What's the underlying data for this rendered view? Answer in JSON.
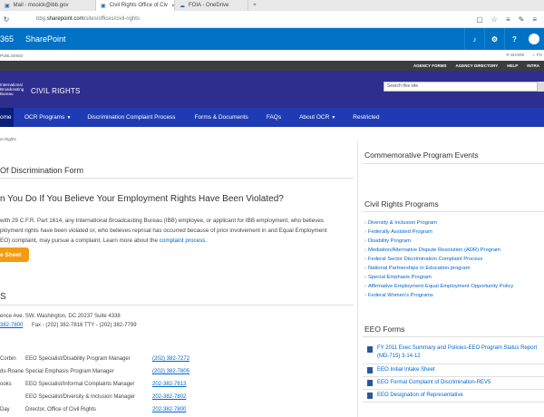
{
  "browser": {
    "tabs": [
      {
        "label": "Mail - mooick@ibb.gov",
        "active": false
      },
      {
        "label": "Civil Rights Office of Civ",
        "active": true
      },
      {
        "label": "FOIA - OneDrive",
        "active": false
      }
    ],
    "new_tab": "+",
    "url_prefix": "bbg.",
    "url_domain": "sharepoint.com",
    "url_path": "/sites/offices/civil-rights"
  },
  "sharepoint": {
    "app_number": "365",
    "app_name": "SharePoint",
    "settings_icon": "⚙",
    "help_icon": "?",
    "bell_icon": "🔔"
  },
  "sharebar": {
    "published": "PUBLISHED",
    "share": "SHARE",
    "follow": "FO"
  },
  "agency": {
    "links": [
      "AGENCY FORMS",
      "AGENCY DIRECTORY",
      "HELP",
      "INTRA"
    ]
  },
  "header": {
    "logo_line1": "International",
    "logo_line2": "Broadcasting",
    "logo_line3": "Bureau",
    "site_name": "CIVIL RIGHTS",
    "search_placeholder": "Search this site"
  },
  "nav": [
    {
      "label": "ome",
      "caret": false
    },
    {
      "label": "OCR Programs",
      "caret": true
    },
    {
      "label": "Discrimination Complaint Process",
      "caret": false
    },
    {
      "label": "Forms & Documents",
      "caret": false
    },
    {
      "label": "FAQs",
      "caret": false
    },
    {
      "label": "About OCR",
      "caret": true
    },
    {
      "label": "Restricted",
      "caret": false
    }
  ],
  "breadcrumb": "et Rights",
  "main": {
    "form_title": "Of Discrimination Form",
    "question_heading": "n You Do If You Believe Your Employment Rights Have Been Violated?",
    "para_line1": "with 29 C.F.R. Part 1614, any International Broadcasting Bureau (IBB) employee, or applicant for IBB employment, who believes",
    "para_line2": "ployment rights have been violated or, who believes reprisal has occurred because of prior involvement in and Equal Employment",
    "para_line3_a": "EO) complaint, may pursue a complaint. Learn more about the ",
    "para_line3_link": "complaint process",
    "para_line3_b": ".",
    "fact_sheet_button": "e Sheet",
    "contact_heading": "S",
    "address": "ence Ave. SW, Washington, DC 20237 Suite 4338",
    "phone_main": "382-7800",
    "fax_tty": "Fax - (202) 382-7816  TTY - (202) 382-7799",
    "staff": [
      {
        "name": "Corbin",
        "title": "EEO Specialist/Disability Program Manager",
        "phone": "(202) 382-7272"
      },
      {
        "name": "ds-Roane",
        "title": "Special Emphasis Program Manager",
        "phone": "(202) 382-7805"
      },
      {
        "name": "ooks",
        "title": "EEO Specialist/Informal Complaints Manager",
        "phone": "202-382-7813"
      },
      {
        "name": "",
        "title": "EEO Specialist/Diversity & Inclusion Manager",
        "phone": "202-382-7802"
      },
      {
        "name": "Day",
        "title": "Director, Office of Civil Rights",
        "phone": "202-382-7800"
      }
    ]
  },
  "right": {
    "events_heading": "Commemorative Program Events",
    "programs_heading": "Civil Rights Programs",
    "programs": [
      "Diversity & Inclusion Program",
      "Federally Assisted Program",
      "Disability Program",
      "Mediation/Alternative Dispute Resolution (ADR) Program",
      "Federal Sector Discrimination Complaint Process",
      "National Partnerships In Education program",
      "Special Emphasis Program",
      "Affirmative Employment-Equal Employment Opportunity Policy",
      "Federal Women's Programs"
    ],
    "forms_heading": "EEO Forms",
    "forms": [
      "FY 2011 Exec Summary and Policies-EEO Program Status Report (MD-715) 3-14-12",
      "EEO Initial Intake Sheet",
      "EEO Formal Complaint of Discrimination-REV5",
      "EEO Designation of Representative"
    ]
  },
  "colors": {
    "sharepoint_blue": "#0072c6",
    "header_purple": "#2e2e8f",
    "nav_blue": "#1f3bb3",
    "nav_active": "#0a1e7a",
    "agency_bar": "#3d3d3d",
    "button_orange": "#f39c12",
    "link_blue": "#0066cc"
  }
}
